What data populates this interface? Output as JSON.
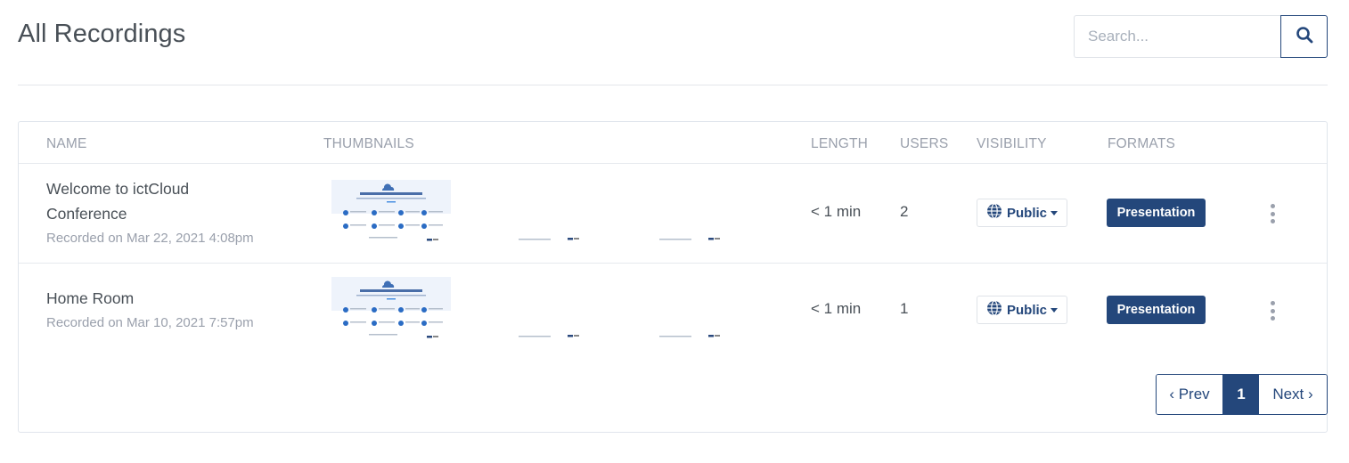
{
  "header": {
    "title": "All Recordings",
    "search_placeholder": "Search...",
    "search_icon": "search-icon"
  },
  "table": {
    "columns": [
      "Name",
      "Thumbnails",
      "Length",
      "Users",
      "Visibility",
      "Formats"
    ],
    "rows": [
      {
        "name": "Welcome to ictCloud Conference",
        "date": "Recorded on Mar 22, 2021 4:08pm",
        "length": "< 1 min",
        "users": "2",
        "visibility": "Public",
        "format": "Presentation"
      },
      {
        "name": "Home Room",
        "date": "Recorded on Mar 10, 2021 7:57pm",
        "length": "< 1 min",
        "users": "1",
        "visibility": "Public",
        "format": "Presentation"
      }
    ]
  },
  "pagination": {
    "prev": "‹ Prev",
    "current": "1",
    "next": "Next ›"
  },
  "colors": {
    "primary": "#24477b",
    "muted_text": "#9aa0ac",
    "body_text": "#495057",
    "border": "#e0e5ec"
  }
}
